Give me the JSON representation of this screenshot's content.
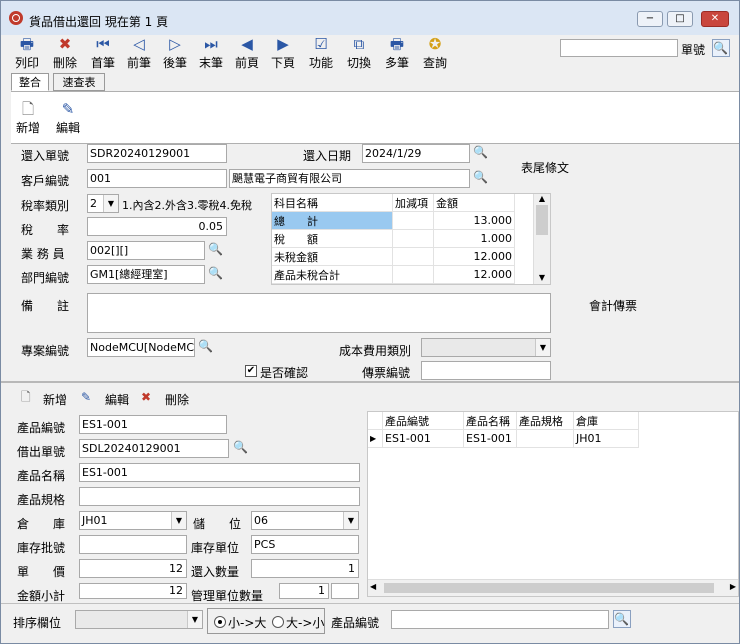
{
  "window": {
    "title": "貨品借出還回 現在第 1 頁",
    "min": "−",
    "max": "□",
    "close": "✕"
  },
  "toolbar": [
    "列印",
    "刪除",
    "首筆",
    "前筆",
    "後筆",
    "末筆",
    "前頁",
    "下頁",
    "功能",
    "切換",
    "多筆",
    "查詢"
  ],
  "search_label": "單號",
  "tabs": [
    "整合",
    "速查表"
  ],
  "record_actions": {
    "new": "新增",
    "edit": "編輯"
  },
  "header": {
    "return_no_label": "還入單號",
    "return_no": "SDR20240129001",
    "return_date_label": "還入日期",
    "return_date": "2024/1/29",
    "footer_text_label": "表尾條文",
    "customer_label": "客戶編號",
    "customer_code": "001",
    "customer_name": "颶慧電子商貿有限公司",
    "tax_type_label": "稅率類別",
    "tax_type": "2",
    "tax_type_hint": "1.內含2.外含3.零稅4.免稅",
    "tax_rate_label": "稅　　率",
    "tax_rate": "0.05",
    "sales_label": "業 務 員",
    "sales": "002[][]",
    "dept_label": "部門編號",
    "dept": "GM1[總經理室]",
    "note_label": "備　　註",
    "accounting_label": "會計傳票",
    "project_label": "專案編號",
    "project": "NodeMCU[NodeMCU]",
    "cost_type_label": "成本費用類別",
    "confirmed_label": "是否確認",
    "voucher_label": "傳票編號"
  },
  "summary": {
    "headers": [
      "科目名稱",
      "加減項",
      "金額"
    ],
    "rows": [
      {
        "name": "總　　計",
        "amount": "13.000"
      },
      {
        "name": "稅　　額",
        "amount": "1.000"
      },
      {
        "name": "未稅金額",
        "amount": "12.000"
      },
      {
        "name": "產品未稅合計",
        "amount": "12.000"
      }
    ]
  },
  "detail_actions": {
    "new": "新增",
    "edit": "編輯",
    "delete": "刪除"
  },
  "detail": {
    "product_no_label": "產品編號",
    "product_no": "ES1-001",
    "lend_no_label": "借出單號",
    "lend_no": "SDL20240129001",
    "product_name_label": "產品名稱",
    "product_name": "ES1-001",
    "spec_label": "產品規格",
    "warehouse_label": "倉　　庫",
    "warehouse": "JH01",
    "location_label": "儲　　位",
    "location": "06",
    "batch_label": "庫存批號",
    "stock_unit_label": "庫存單位",
    "stock_unit": "PCS",
    "price_label": "單　　價",
    "price": "12",
    "qty_label": "還入數量",
    "qty": "1",
    "subtotal_label": "金額小計",
    "subtotal": "12",
    "mgmt_qty_label": "管理單位數量",
    "mgmt_qty": "1"
  },
  "plist": {
    "headers": [
      "產品編號",
      "產品名稱",
      "產品規格",
      "倉庫"
    ],
    "rows": [
      {
        "code": "ES1-001",
        "name": "ES1-001",
        "spec": "",
        "wh": "JH01"
      }
    ]
  },
  "bottom": {
    "sort_label": "排序欄位",
    "asc": "小->大",
    "desc": "大->小",
    "product_label": "產品編號"
  }
}
